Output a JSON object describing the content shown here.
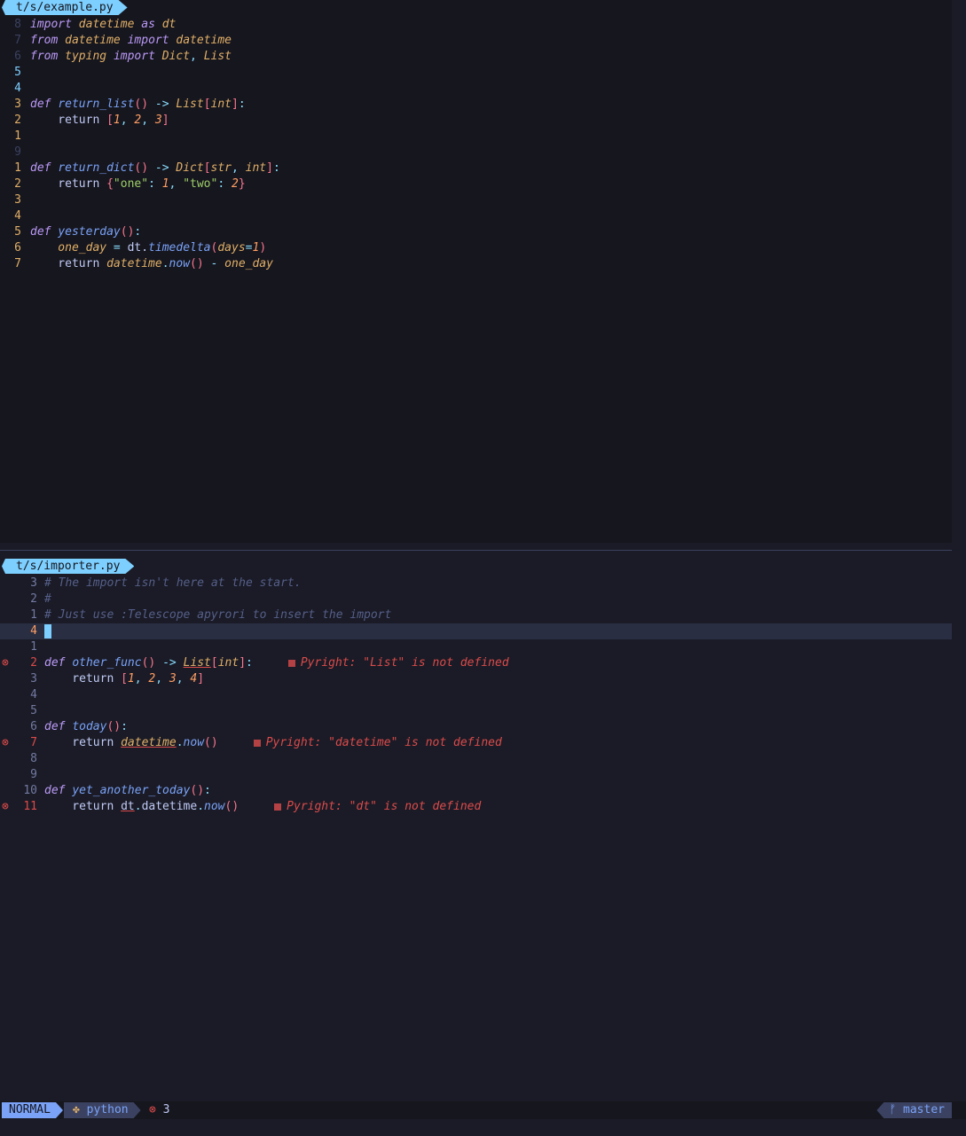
{
  "top": {
    "filename": "t/s/example.py",
    "lines": [
      {
        "ln": "8",
        "tokens": [
          [
            "kw",
            "import "
          ],
          [
            "var",
            "datetime "
          ],
          [
            "kw",
            "as "
          ],
          [
            "var",
            "dt"
          ]
        ]
      },
      {
        "ln": "7",
        "tokens": [
          [
            "kw",
            "from "
          ],
          [
            "var",
            "datetime "
          ],
          [
            "kw",
            "import "
          ],
          [
            "var",
            "datetime"
          ]
        ]
      },
      {
        "ln": "6",
        "tokens": [
          [
            "kw",
            "from "
          ],
          [
            "var",
            "typing "
          ],
          [
            "kw",
            "import "
          ],
          [
            "ty",
            "Dict"
          ],
          [
            "op",
            ", "
          ],
          [
            "ty",
            "List"
          ]
        ]
      },
      {
        "ln": "5",
        "tokens": []
      },
      {
        "ln": "4",
        "tokens": []
      },
      {
        "ln": "3",
        "tokens": [
          [
            "def",
            "def "
          ],
          [
            "fn",
            "return_list"
          ],
          [
            "par",
            "()"
          ],
          [
            "op",
            " -> "
          ],
          [
            "ty",
            "List"
          ],
          [
            "par",
            "["
          ],
          [
            "ty",
            "int"
          ],
          [
            "par",
            "]"
          ],
          [
            "op",
            ":"
          ]
        ]
      },
      {
        "ln": "2",
        "tokens": [
          [
            "bool",
            "    return "
          ],
          [
            "par",
            "["
          ],
          [
            "num",
            "1"
          ],
          [
            "op",
            ", "
          ],
          [
            "num",
            "2"
          ],
          [
            "op",
            ", "
          ],
          [
            "num",
            "3"
          ],
          [
            "par",
            "]"
          ]
        ]
      },
      {
        "ln": "1",
        "tokens": []
      },
      {
        "ln": "9",
        "tokens": []
      },
      {
        "ln": "1",
        "tokens": [
          [
            "def",
            "def "
          ],
          [
            "fn",
            "return_dict"
          ],
          [
            "par",
            "()"
          ],
          [
            "op",
            " -> "
          ],
          [
            "ty",
            "Dict"
          ],
          [
            "par",
            "["
          ],
          [
            "ty",
            "str"
          ],
          [
            "op",
            ", "
          ],
          [
            "ty",
            "int"
          ],
          [
            "par",
            "]"
          ],
          [
            "op",
            ":"
          ]
        ]
      },
      {
        "ln": "2",
        "tokens": [
          [
            "bool",
            "    return "
          ],
          [
            "par",
            "{"
          ],
          [
            "str",
            "\"one\""
          ],
          [
            "op",
            ": "
          ],
          [
            "num",
            "1"
          ],
          [
            "op",
            ", "
          ],
          [
            "str",
            "\"two\""
          ],
          [
            "op",
            ": "
          ],
          [
            "num",
            "2"
          ],
          [
            "par",
            "}"
          ]
        ]
      },
      {
        "ln": "3",
        "tokens": []
      },
      {
        "ln": "4",
        "tokens": []
      },
      {
        "ln": "5",
        "tokens": [
          [
            "def",
            "def "
          ],
          [
            "fn",
            "yesterday"
          ],
          [
            "par",
            "()"
          ],
          [
            "op",
            ":"
          ]
        ]
      },
      {
        "ln": "6",
        "tokens": [
          [
            "var",
            "    one_day "
          ],
          [
            "op",
            "= "
          ],
          [
            "bool",
            "dt."
          ],
          [
            "meth",
            "timedelta"
          ],
          [
            "par",
            "("
          ],
          [
            "var",
            "days"
          ],
          [
            "op",
            "="
          ],
          [
            "num",
            "1"
          ],
          [
            "par",
            ")"
          ]
        ]
      },
      {
        "ln": "7",
        "tokens": [
          [
            "bool",
            "    return "
          ],
          [
            "var",
            "datetime"
          ],
          [
            "op",
            "."
          ],
          [
            "meth",
            "now"
          ],
          [
            "par",
            "()"
          ],
          [
            "op",
            " - "
          ],
          [
            "var",
            "one_day"
          ]
        ]
      }
    ]
  },
  "bottom": {
    "filename": "t/s/importer.py",
    "lines": [
      {
        "ln": "3",
        "tokens": [
          [
            "cm",
            "# The import isn't here at the start."
          ]
        ]
      },
      {
        "ln": "2",
        "tokens": [
          [
            "cm",
            "#"
          ]
        ]
      },
      {
        "ln": "1",
        "tokens": [
          [
            "cm",
            "# Just use :Telescope apyrori to insert the import"
          ]
        ]
      },
      {
        "ln": "4",
        "current": true,
        "tokens": []
      },
      {
        "ln": "1",
        "tokens": []
      },
      {
        "ln": "2",
        "sign": "⊗",
        "tokens": [
          [
            "def",
            "def "
          ],
          [
            "fn",
            "other_func"
          ],
          [
            "par",
            "()"
          ],
          [
            "op",
            " -> "
          ],
          [
            "tyu",
            "List"
          ],
          [
            "par",
            "["
          ],
          [
            "ty",
            "int"
          ],
          [
            "par",
            "]"
          ],
          [
            "op",
            ":"
          ]
        ],
        "diag": "Pyright: \"List\" is not defined"
      },
      {
        "ln": "3",
        "tokens": [
          [
            "bool",
            "    return "
          ],
          [
            "par",
            "["
          ],
          [
            "num",
            "1"
          ],
          [
            "op",
            ", "
          ],
          [
            "num",
            "2"
          ],
          [
            "op",
            ", "
          ],
          [
            "num",
            "3"
          ],
          [
            "op",
            ", "
          ],
          [
            "num",
            "4"
          ],
          [
            "par",
            "]"
          ]
        ]
      },
      {
        "ln": "4",
        "tokens": []
      },
      {
        "ln": "5",
        "tokens": []
      },
      {
        "ln": "6",
        "tokens": [
          [
            "def",
            "def "
          ],
          [
            "fn",
            "today"
          ],
          [
            "par",
            "()"
          ],
          [
            "op",
            ":"
          ]
        ]
      },
      {
        "ln": "7",
        "sign": "⊗",
        "tokens": [
          [
            "bool",
            "    return "
          ],
          [
            "varu",
            "datetime"
          ],
          [
            "op",
            "."
          ],
          [
            "meth",
            "now"
          ],
          [
            "par",
            "()"
          ]
        ],
        "diag": "Pyright: \"datetime\" is not defined"
      },
      {
        "ln": "8",
        "tokens": []
      },
      {
        "ln": "9",
        "tokens": []
      },
      {
        "ln": "10",
        "tokens": [
          [
            "def",
            "def "
          ],
          [
            "fn",
            "yet_another_today"
          ],
          [
            "par",
            "()"
          ],
          [
            "op",
            ":"
          ]
        ]
      },
      {
        "ln": "11",
        "sign": "⊗",
        "tokens": [
          [
            "bool",
            "    return "
          ],
          [
            "boolu",
            "dt"
          ],
          [
            "op",
            "."
          ],
          [
            "bool",
            "datetime"
          ],
          [
            "op",
            "."
          ],
          [
            "meth",
            "now"
          ],
          [
            "par",
            "()"
          ]
        ],
        "diag": "Pyright: \"dt\" is not defined"
      }
    ]
  },
  "status": {
    "mode": "NORMAL",
    "filetype": "python",
    "error_icon": "⊗",
    "error_count": "3",
    "branch_icon": "ᚠ",
    "branch": "master"
  }
}
